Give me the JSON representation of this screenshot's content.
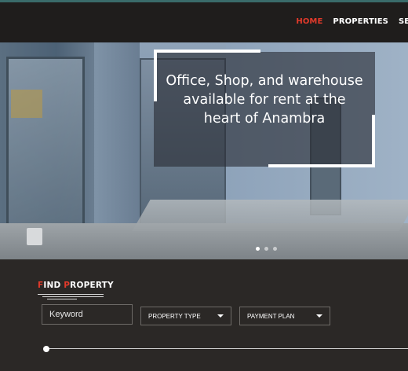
{
  "nav": {
    "items": [
      {
        "label": "HOME",
        "active": true
      },
      {
        "label": "PROPERTIES",
        "active": false
      },
      {
        "label": "SER",
        "active": false
      }
    ]
  },
  "hero": {
    "caption": "Office, Shop, and warehouse available for rent at the heart of Anambra",
    "slides": 3,
    "active_slide": 1
  },
  "search": {
    "title_first_letter": "F",
    "title_mid": "IND ",
    "title_second_letter": "P",
    "title_rest": "ROPERTY",
    "keyword_placeholder": "Keyword",
    "property_type_label": "PROPERTY TYPE",
    "payment_plan_label": "PAYMENT PLAN",
    "price_slider_value": 0
  },
  "colors": {
    "accent": "#e23a2b",
    "background": "#2b2826",
    "topbar": "#1f1d1c"
  }
}
